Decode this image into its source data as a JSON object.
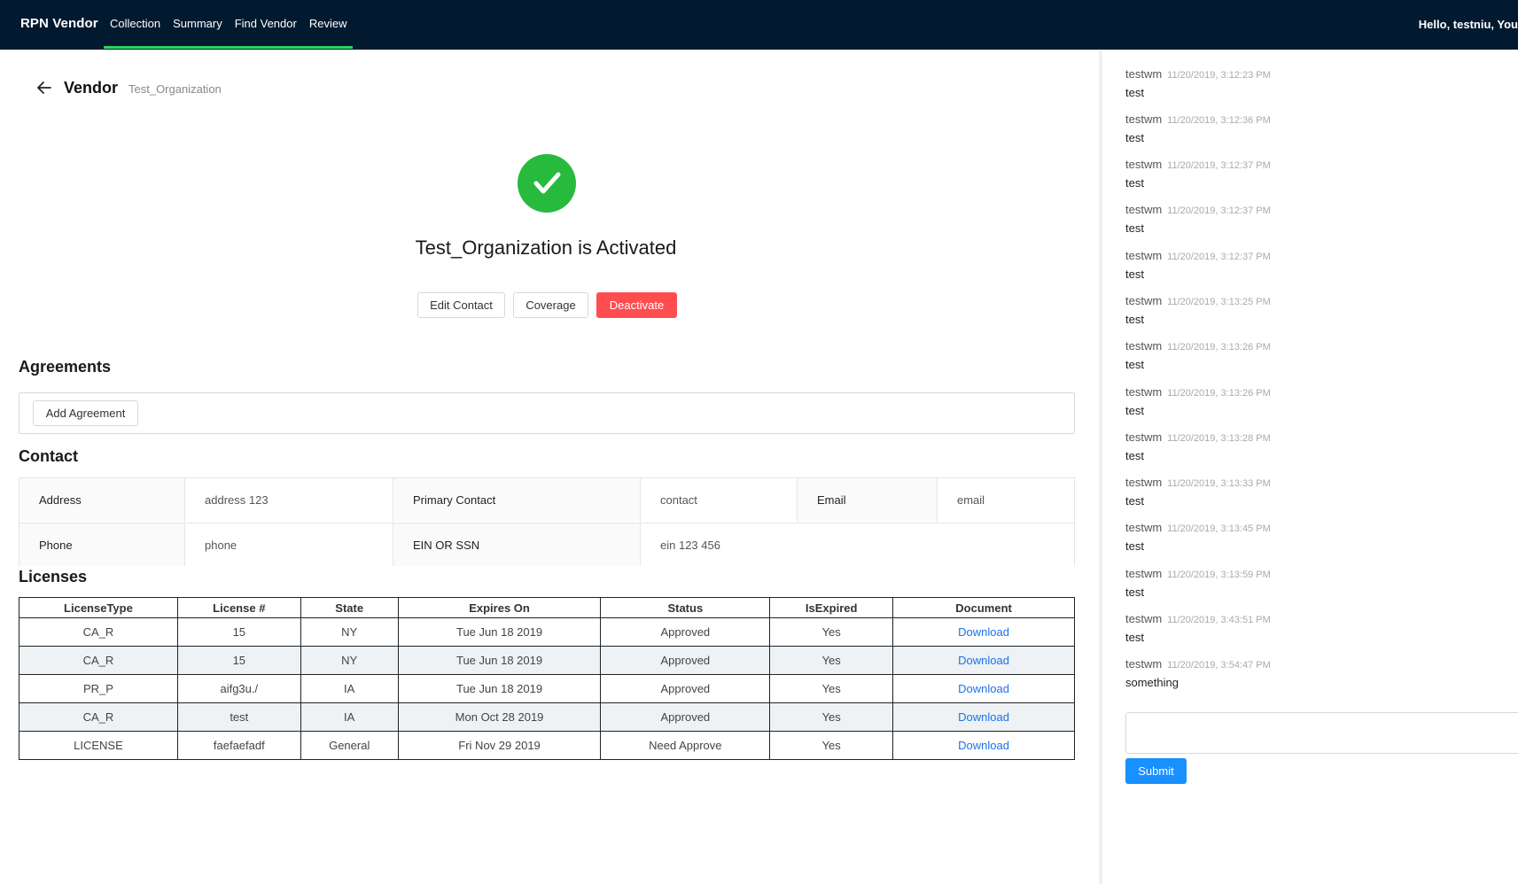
{
  "app": {
    "brand": "RPN Vendor",
    "nav": [
      "Collection",
      "Summary",
      "Find Vendor",
      "Review"
    ],
    "greeting": "Hello, testniu, You"
  },
  "header": {
    "title": "Vendor",
    "subtitle": "Test_Organization"
  },
  "status": {
    "message": "Test_Organization is Activated",
    "color": "#27ba3c"
  },
  "actions": {
    "edit_contact": "Edit Contact",
    "coverage": "Coverage",
    "deactivate": "Deactivate"
  },
  "agreements": {
    "title": "Agreements",
    "add_button": "Add Agreement"
  },
  "contact": {
    "title": "Contact",
    "address_label": "Address",
    "address_value": "address 123",
    "primary_contact_label": "Primary Contact",
    "primary_contact_value": "contact",
    "email_label": "Email",
    "email_value": "email",
    "phone_label": "Phone",
    "phone_value": "phone",
    "ein_label": "EIN OR SSN",
    "ein_value": "ein 123 456"
  },
  "licenses": {
    "title": "Licenses",
    "columns": [
      "LicenseType",
      "License #",
      "State",
      "Expires On",
      "Status",
      "IsExpired",
      "Document"
    ],
    "rows": [
      [
        "CA_R",
        "15",
        "NY",
        "Tue Jun 18 2019",
        "Approved",
        "Yes",
        "Download"
      ],
      [
        "CA_R",
        "15",
        "NY",
        "Tue Jun 18 2019",
        "Approved",
        "Yes",
        "Download"
      ],
      [
        "PR_P",
        "aifg3u./",
        "IA",
        "Tue Jun 18 2019",
        "Approved",
        "Yes",
        "Download"
      ],
      [
        "CA_R",
        "test",
        "IA",
        "Mon Oct 28 2019",
        "Approved",
        "Yes",
        "Download"
      ],
      [
        "LICENSE",
        "faefaefadf",
        "General",
        "Fri Nov 29 2019",
        "Need Approve",
        "Yes",
        "Download"
      ]
    ]
  },
  "comments": {
    "cut_off_text": "test",
    "items": [
      {
        "author": "testwm",
        "time": "11/20/2019, 3:12:23 PM",
        "text": "test"
      },
      {
        "author": "testwm",
        "time": "11/20/2019, 3:12:36 PM",
        "text": "test"
      },
      {
        "author": "testwm",
        "time": "11/20/2019, 3:12:37 PM",
        "text": "test"
      },
      {
        "author": "testwm",
        "time": "11/20/2019, 3:12:37 PM",
        "text": "test"
      },
      {
        "author": "testwm",
        "time": "11/20/2019, 3:12:37 PM",
        "text": "test"
      },
      {
        "author": "testwm",
        "time": "11/20/2019, 3:13:25 PM",
        "text": "test"
      },
      {
        "author": "testwm",
        "time": "11/20/2019, 3:13:26 PM",
        "text": "test"
      },
      {
        "author": "testwm",
        "time": "11/20/2019, 3:13:26 PM",
        "text": "test"
      },
      {
        "author": "testwm",
        "time": "11/20/2019, 3:13:28 PM",
        "text": "test"
      },
      {
        "author": "testwm",
        "time": "11/20/2019, 3:13:33 PM",
        "text": "test"
      },
      {
        "author": "testwm",
        "time": "11/20/2019, 3:13:45 PM",
        "text": "test"
      },
      {
        "author": "testwm",
        "time": "11/20/2019, 3:13:59 PM",
        "text": "test"
      },
      {
        "author": "testwm",
        "time": "11/20/2019, 3:43:51 PM",
        "text": "test"
      },
      {
        "author": "testwm",
        "time": "11/20/2019, 3:54:47 PM",
        "text": "something"
      }
    ],
    "input_value": "",
    "submit_label": "Submit"
  }
}
